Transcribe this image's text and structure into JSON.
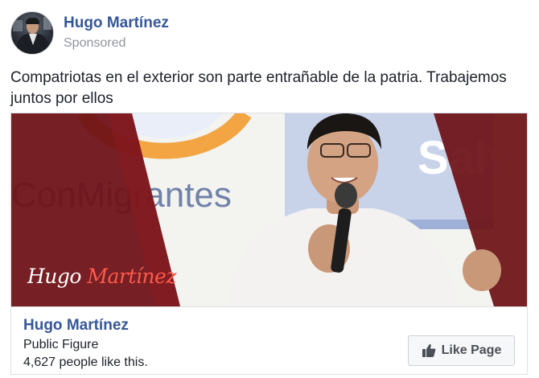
{
  "post": {
    "author_name": "Hugo Martínez",
    "sponsored_label": "Sponsored",
    "text": "Compatriotas en el exterior son parte entrañable de la patria. Trabajemos juntos por ellos"
  },
  "ad": {
    "image": {
      "background_text_left": "ConMigrantes",
      "background_text_right": "Salv",
      "brand_script_first": "Hugo",
      "brand_script_second": "Martínez"
    },
    "footer": {
      "page_name": "Hugo Martínez",
      "page_category": "Public Figure",
      "page_likes": "4,627 people like this.",
      "like_button_label": "Like Page"
    }
  },
  "colors": {
    "link_blue": "#365899",
    "muted_gray": "#90949c",
    "banner_red": "#6d1116",
    "button_bg": "#f6f7f9"
  },
  "icons": {
    "avatar": "profile-photo",
    "like_button": "thumbs-up-icon"
  }
}
